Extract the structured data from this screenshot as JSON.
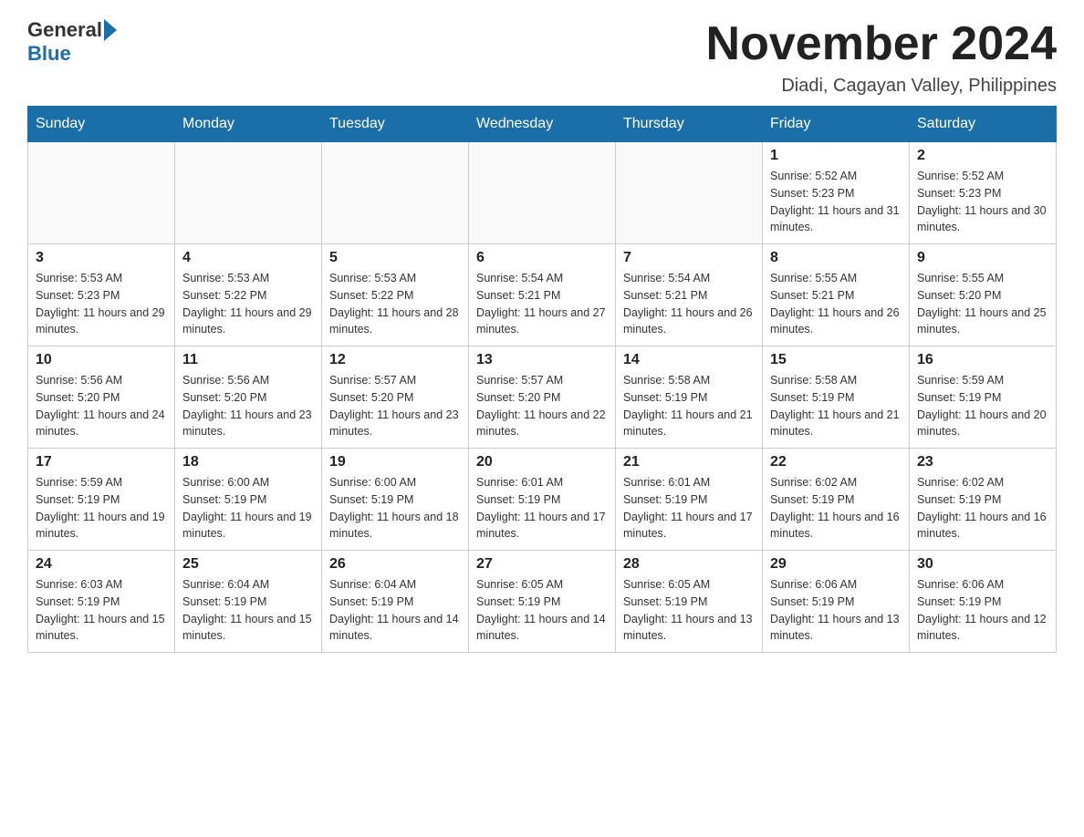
{
  "logo": {
    "general": "General",
    "blue": "Blue"
  },
  "title": "November 2024",
  "location": "Diadi, Cagayan Valley, Philippines",
  "weekdays": [
    "Sunday",
    "Monday",
    "Tuesday",
    "Wednesday",
    "Thursday",
    "Friday",
    "Saturday"
  ],
  "weeks": [
    [
      {
        "day": "",
        "info": ""
      },
      {
        "day": "",
        "info": ""
      },
      {
        "day": "",
        "info": ""
      },
      {
        "day": "",
        "info": ""
      },
      {
        "day": "",
        "info": ""
      },
      {
        "day": "1",
        "info": "Sunrise: 5:52 AM\nSunset: 5:23 PM\nDaylight: 11 hours and 31 minutes."
      },
      {
        "day": "2",
        "info": "Sunrise: 5:52 AM\nSunset: 5:23 PM\nDaylight: 11 hours and 30 minutes."
      }
    ],
    [
      {
        "day": "3",
        "info": "Sunrise: 5:53 AM\nSunset: 5:23 PM\nDaylight: 11 hours and 29 minutes."
      },
      {
        "day": "4",
        "info": "Sunrise: 5:53 AM\nSunset: 5:22 PM\nDaylight: 11 hours and 29 minutes."
      },
      {
        "day": "5",
        "info": "Sunrise: 5:53 AM\nSunset: 5:22 PM\nDaylight: 11 hours and 28 minutes."
      },
      {
        "day": "6",
        "info": "Sunrise: 5:54 AM\nSunset: 5:21 PM\nDaylight: 11 hours and 27 minutes."
      },
      {
        "day": "7",
        "info": "Sunrise: 5:54 AM\nSunset: 5:21 PM\nDaylight: 11 hours and 26 minutes."
      },
      {
        "day": "8",
        "info": "Sunrise: 5:55 AM\nSunset: 5:21 PM\nDaylight: 11 hours and 26 minutes."
      },
      {
        "day": "9",
        "info": "Sunrise: 5:55 AM\nSunset: 5:20 PM\nDaylight: 11 hours and 25 minutes."
      }
    ],
    [
      {
        "day": "10",
        "info": "Sunrise: 5:56 AM\nSunset: 5:20 PM\nDaylight: 11 hours and 24 minutes."
      },
      {
        "day": "11",
        "info": "Sunrise: 5:56 AM\nSunset: 5:20 PM\nDaylight: 11 hours and 23 minutes."
      },
      {
        "day": "12",
        "info": "Sunrise: 5:57 AM\nSunset: 5:20 PM\nDaylight: 11 hours and 23 minutes."
      },
      {
        "day": "13",
        "info": "Sunrise: 5:57 AM\nSunset: 5:20 PM\nDaylight: 11 hours and 22 minutes."
      },
      {
        "day": "14",
        "info": "Sunrise: 5:58 AM\nSunset: 5:19 PM\nDaylight: 11 hours and 21 minutes."
      },
      {
        "day": "15",
        "info": "Sunrise: 5:58 AM\nSunset: 5:19 PM\nDaylight: 11 hours and 21 minutes."
      },
      {
        "day": "16",
        "info": "Sunrise: 5:59 AM\nSunset: 5:19 PM\nDaylight: 11 hours and 20 minutes."
      }
    ],
    [
      {
        "day": "17",
        "info": "Sunrise: 5:59 AM\nSunset: 5:19 PM\nDaylight: 11 hours and 19 minutes."
      },
      {
        "day": "18",
        "info": "Sunrise: 6:00 AM\nSunset: 5:19 PM\nDaylight: 11 hours and 19 minutes."
      },
      {
        "day": "19",
        "info": "Sunrise: 6:00 AM\nSunset: 5:19 PM\nDaylight: 11 hours and 18 minutes."
      },
      {
        "day": "20",
        "info": "Sunrise: 6:01 AM\nSunset: 5:19 PM\nDaylight: 11 hours and 17 minutes."
      },
      {
        "day": "21",
        "info": "Sunrise: 6:01 AM\nSunset: 5:19 PM\nDaylight: 11 hours and 17 minutes."
      },
      {
        "day": "22",
        "info": "Sunrise: 6:02 AM\nSunset: 5:19 PM\nDaylight: 11 hours and 16 minutes."
      },
      {
        "day": "23",
        "info": "Sunrise: 6:02 AM\nSunset: 5:19 PM\nDaylight: 11 hours and 16 minutes."
      }
    ],
    [
      {
        "day": "24",
        "info": "Sunrise: 6:03 AM\nSunset: 5:19 PM\nDaylight: 11 hours and 15 minutes."
      },
      {
        "day": "25",
        "info": "Sunrise: 6:04 AM\nSunset: 5:19 PM\nDaylight: 11 hours and 15 minutes."
      },
      {
        "day": "26",
        "info": "Sunrise: 6:04 AM\nSunset: 5:19 PM\nDaylight: 11 hours and 14 minutes."
      },
      {
        "day": "27",
        "info": "Sunrise: 6:05 AM\nSunset: 5:19 PM\nDaylight: 11 hours and 14 minutes."
      },
      {
        "day": "28",
        "info": "Sunrise: 6:05 AM\nSunset: 5:19 PM\nDaylight: 11 hours and 13 minutes."
      },
      {
        "day": "29",
        "info": "Sunrise: 6:06 AM\nSunset: 5:19 PM\nDaylight: 11 hours and 13 minutes."
      },
      {
        "day": "30",
        "info": "Sunrise: 6:06 AM\nSunset: 5:19 PM\nDaylight: 11 hours and 12 minutes."
      }
    ]
  ]
}
